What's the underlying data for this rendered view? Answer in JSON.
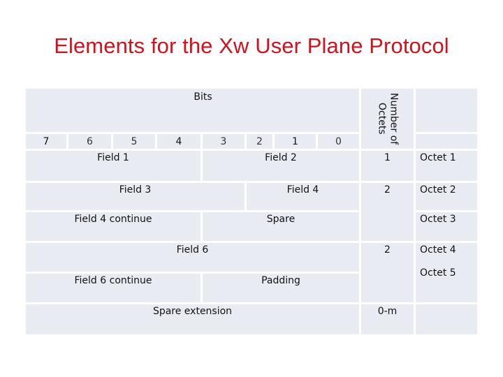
{
  "title": "Elements for the Xw User Plane Protocol",
  "table": {
    "bits_header": "Bits",
    "octets_header": "Number of\nOctets",
    "bit_numbers": [
      "7",
      "6",
      "5",
      "4",
      "3",
      "2",
      "1",
      "0"
    ],
    "rows": [
      {
        "fields": [
          "Field 1",
          "Field 2"
        ],
        "octets": "1",
        "octet_labels": [
          "Octet 1"
        ]
      },
      {
        "fields": [
          "Field 3",
          "Field 4"
        ],
        "octets": "2",
        "octet_labels": [
          "Octet 2"
        ]
      },
      {
        "fields": [
          "Field 4 continue",
          "Spare"
        ],
        "octets": "",
        "octet_labels": [
          "Octet 3"
        ]
      },
      {
        "fields": [
          "Field 6"
        ],
        "octets": "2",
        "octet_labels": [
          "Octet 4",
          "Octet 5"
        ]
      },
      {
        "fields": [
          "Field 6 continue",
          "Padding"
        ],
        "octets": "",
        "octet_labels": []
      },
      {
        "fields": [
          "Spare extension"
        ],
        "octets": "0-m",
        "octet_labels": []
      }
    ]
  },
  "colors": {
    "title": "#d0121b",
    "cell_background": "#e8ebf1",
    "grid_line": "#ffffff"
  }
}
